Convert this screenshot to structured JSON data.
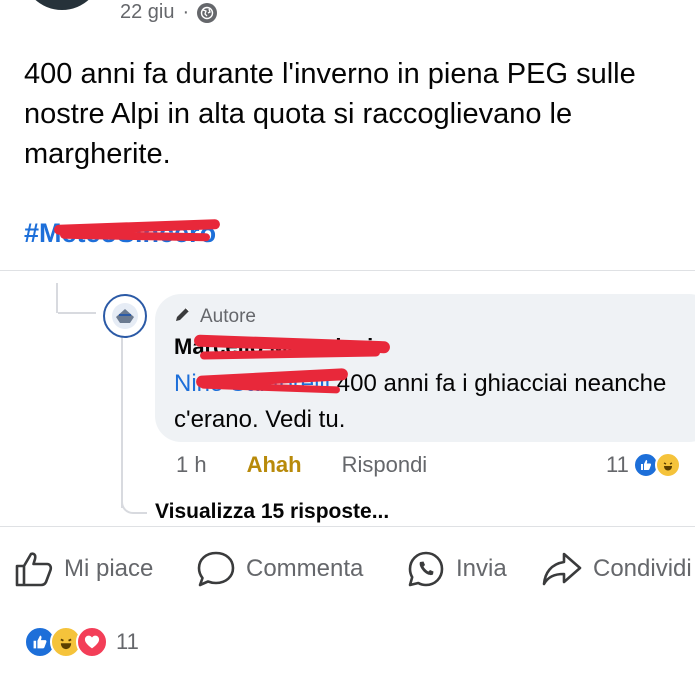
{
  "post": {
    "time": "22 giu",
    "separator": "·",
    "audience_icon": "globe-icon",
    "text": "400 anni fa durante l'inverno in piena PEG sulle\nnostre Alpi in alta quota si raccoglievano le\nmargherite.",
    "hashtag": "#MeteoSincero"
  },
  "comment": {
    "badge_label": "Autore",
    "author_name": "Marcello Mazzoleni",
    "mention": "Nino Santorelli",
    "text": " 400 anni fa i ghiacciai neanche c'erano. Vedi tu.",
    "time": "1 h",
    "reaction_action": "Ahah",
    "reply_label": "Rispondi",
    "reaction_count": "11",
    "view_replies": "Visualizza 15 risposte..."
  },
  "post_actions": {
    "like": "Mi piace",
    "comment": "Commenta",
    "send": "Invia",
    "share": "Condividi"
  },
  "post_reactions": {
    "count": "11"
  },
  "colors": {
    "link_blue": "#1d6fd9",
    "redaction": "#e8283a",
    "bubble_bg": "#eff2f5",
    "secondary_text": "#65676b"
  }
}
